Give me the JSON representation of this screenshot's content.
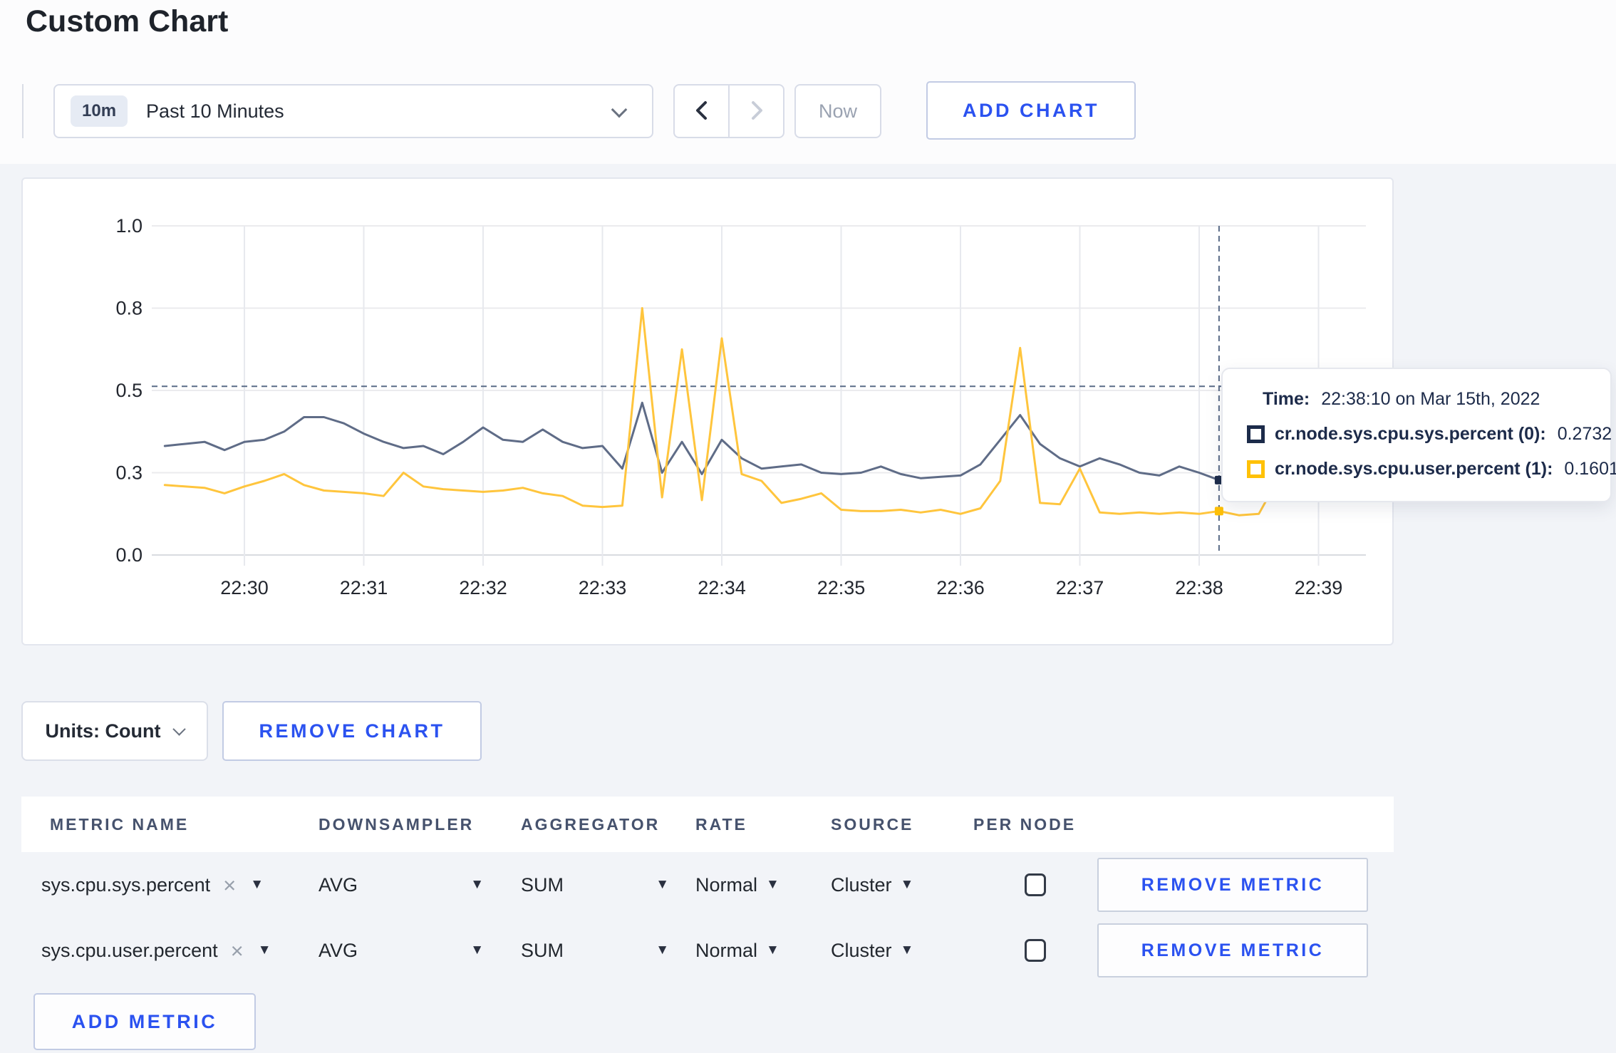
{
  "page": {
    "title": "Custom Chart"
  },
  "toolbar": {
    "time_badge": "10m",
    "time_label": "Past 10 Minutes",
    "now_label": "Now",
    "add_chart_label": "ADD CHART"
  },
  "glyphs": {
    "caret": "▼",
    "close": "×"
  },
  "chart_controls": {
    "units_label": "Units: Count",
    "remove_chart_label": "REMOVE CHART",
    "add_metric_label": "ADD METRIC"
  },
  "tooltip": {
    "time_label": "Time:",
    "time_value": "22:38:10 on Mar 15th, 2022",
    "series": [
      {
        "label": "cr.node.sys.cpu.sys.percent (0):",
        "value": "0.2732",
        "swatch_color": "#1c2b4a"
      },
      {
        "label": "cr.node.sys.cpu.user.percent (1):",
        "value": "0.1601",
        "swatch_color": "#ffc107"
      }
    ]
  },
  "metrics_table": {
    "headers": [
      "METRIC NAME",
      "DOWNSAMPLER",
      "AGGREGATOR",
      "RATE",
      "SOURCE",
      "PER NODE"
    ],
    "rows": [
      {
        "metric": "sys.cpu.sys.percent",
        "downsampler": "AVG",
        "aggregator": "SUM",
        "rate": "Normal",
        "source": "Cluster",
        "per_node": false,
        "remove_label": "REMOVE METRIC"
      },
      {
        "metric": "sys.cpu.user.percent",
        "downsampler": "AVG",
        "aggregator": "SUM",
        "rate": "Normal",
        "source": "Cluster",
        "per_node": false,
        "remove_label": "REMOVE METRIC"
      }
    ]
  },
  "chart_data": {
    "type": "line",
    "title": "",
    "xlabel": "",
    "ylabel": "",
    "x_ticks": [
      "22:30",
      "22:31",
      "22:32",
      "22:33",
      "22:34",
      "22:35",
      "22:36",
      "22:37",
      "22:38",
      "22:39"
    ],
    "y_ticks": [
      0.0,
      0.3,
      0.5,
      0.8,
      1.0
    ],
    "x_start": "22:29:20",
    "x_interval_seconds": 10,
    "grid": true,
    "legend_position": "tooltip",
    "guide_value": 0.515,
    "crosshair": {
      "index": 53,
      "time": "22:38:10"
    },
    "series": [
      {
        "name": "cr.node.sys.cpu.sys.percent",
        "line_color": "#5f6c87",
        "swatch_color": "#1c2b4a",
        "values": [
          0.365,
          0.37,
          0.375,
          0.355,
          0.375,
          0.38,
          0.4,
          0.435,
          0.435,
          0.42,
          0.395,
          0.375,
          0.36,
          0.365,
          0.345,
          0.375,
          0.41,
          0.38,
          0.375,
          0.405,
          0.375,
          0.36,
          0.365,
          0.31,
          0.47,
          0.3,
          0.375,
          0.295,
          0.38,
          0.335,
          0.31,
          0.315,
          0.32,
          0.3,
          0.295,
          0.3,
          0.315,
          0.295,
          0.28,
          0.285,
          0.29,
          0.32,
          0.38,
          0.44,
          0.37,
          0.335,
          0.315,
          0.335,
          0.32,
          0.3,
          0.29,
          0.315,
          0.3,
          0.2732,
          0.3,
          0.305,
          0.3,
          0.295,
          0.3
        ]
      },
      {
        "name": "cr.node.sys.cpu.user.percent",
        "line_color": "#ffc53d",
        "swatch_color": "#ffc107",
        "values": [
          0.255,
          0.25,
          0.245,
          0.225,
          0.25,
          0.27,
          0.295,
          0.255,
          0.235,
          0.23,
          0.225,
          0.215,
          0.3,
          0.25,
          0.24,
          0.235,
          0.23,
          0.235,
          0.245,
          0.225,
          0.215,
          0.18,
          0.175,
          0.18,
          0.8,
          0.21,
          0.65,
          0.2,
          0.69,
          0.295,
          0.27,
          0.19,
          0.205,
          0.225,
          0.165,
          0.16,
          0.16,
          0.165,
          0.155,
          0.165,
          0.15,
          0.17,
          0.27,
          0.655,
          0.19,
          0.185,
          0.31,
          0.155,
          0.15,
          0.155,
          0.15,
          0.155,
          0.15,
          0.1601,
          0.145,
          0.15,
          0.28,
          0.285,
          0.26
        ]
      }
    ]
  }
}
